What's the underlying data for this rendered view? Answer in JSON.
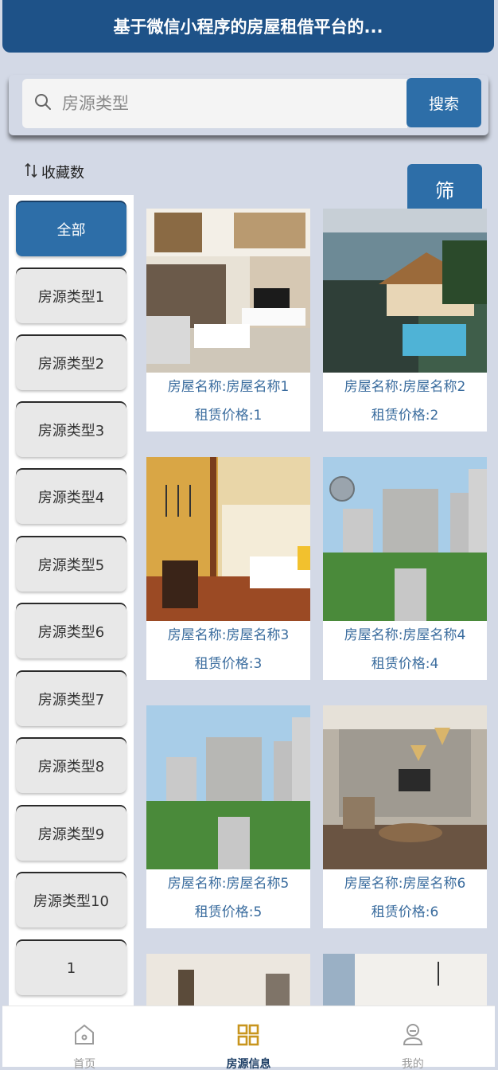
{
  "header": {
    "title": "基于微信小程序的房屋租借平台的..."
  },
  "search": {
    "placeholder": "房源类型",
    "button_label": "搜索"
  },
  "sort": {
    "label": "收藏数"
  },
  "filter": {
    "button_label": "筛"
  },
  "categories": {
    "all": "全部",
    "items": [
      "房源类型1",
      "房源类型2",
      "房源类型3",
      "房源类型4",
      "房源类型5",
      "房源类型6",
      "房源类型7",
      "房源类型8",
      "房源类型9",
      "房源类型10",
      "1"
    ]
  },
  "listings": [
    {
      "name": "房屋名称:房屋名称1",
      "price": "租赁价格:1"
    },
    {
      "name": "房屋名称:房屋名称2",
      "price": "租赁价格:2"
    },
    {
      "name": "房屋名称:房屋名称3",
      "price": "租赁价格:3"
    },
    {
      "name": "房屋名称:房屋名称4",
      "price": "租赁价格:4"
    },
    {
      "name": "房屋名称:房屋名称5",
      "price": "租赁价格:5"
    },
    {
      "name": "房屋名称:房屋名称6",
      "price": "租赁价格:6"
    }
  ],
  "tabbar": {
    "home": "首页",
    "listings": "房源信息",
    "mine": "我的"
  },
  "colors": {
    "brand": "#1e5288",
    "accent": "#2d6ea8",
    "background": "#d3d9e6"
  }
}
